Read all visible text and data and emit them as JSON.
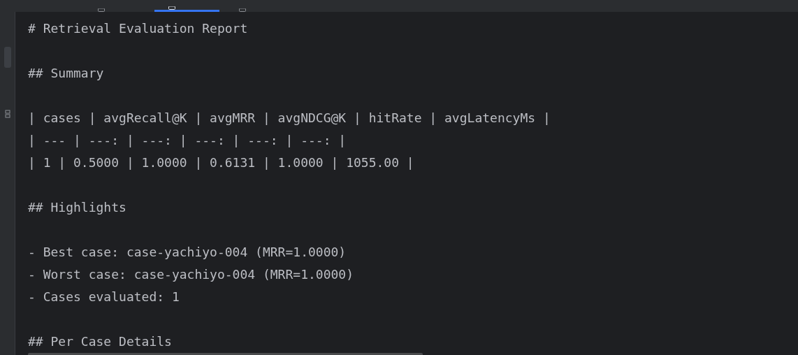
{
  "editor_tabs": [
    {
      "selected": false
    },
    {
      "selected": true
    },
    {
      "selected": false
    }
  ],
  "lines": [
    {
      "kind": "text",
      "text": "# Retrieval Evaluation Report"
    },
    {
      "kind": "blank"
    },
    {
      "kind": "text",
      "text": "## Summary"
    },
    {
      "kind": "blank"
    },
    {
      "kind": "text",
      "text": "| cases | avgRecall@K | avgMRR | avgNDCG@K | hitRate | avgLatencyMs |"
    },
    {
      "kind": "text",
      "text": "| --- | ---: | ---: | ---: | ---: | ---: |"
    },
    {
      "kind": "text",
      "text": "| 1 | 0.5000 | 1.0000 | 0.6131 | 1.0000 | 1055.00 |"
    },
    {
      "kind": "blank"
    },
    {
      "kind": "text",
      "text": "## Highlights"
    },
    {
      "kind": "blank"
    },
    {
      "kind": "text",
      "text": "- Best case: case-yachiyo-004 (MRR=1.0000)"
    },
    {
      "kind": "text",
      "text": "- Worst case: case-yachiyo-004 (MRR=1.0000)"
    },
    {
      "kind": "text",
      "text": "- Cases evaluated: 1"
    },
    {
      "kind": "blank"
    },
    {
      "kind": "text",
      "text": "## Per Case Details"
    }
  ]
}
